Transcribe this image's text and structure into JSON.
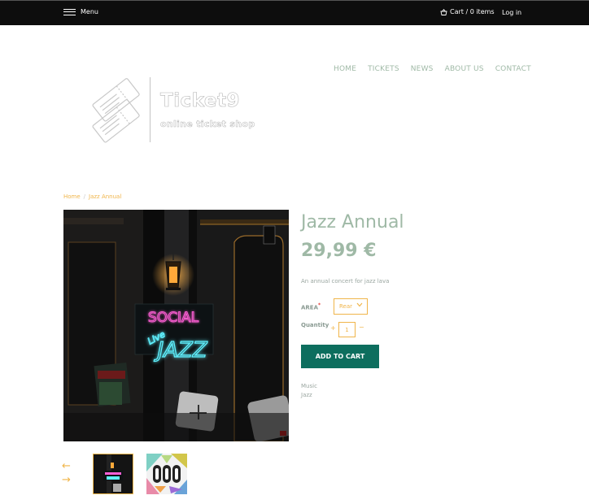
{
  "topbar": {
    "menu_label": "Menu",
    "cart_label": "Cart / 0 items",
    "login_label": "Log in"
  },
  "nav": {
    "items": [
      "HOME",
      "TICKETS",
      "NEWS",
      "ABOUT US",
      "CONTACT"
    ]
  },
  "logo": {
    "title": "Ticket9",
    "subtitle": "online ticket shop"
  },
  "breadcrumb": {
    "home": "Home",
    "separator": "/",
    "current": "Jazz Annual"
  },
  "product": {
    "title": "Jazz Annual",
    "price": "29,99 €",
    "description": "An annual concert for jazz lava",
    "area_label": "AREA",
    "area_required": "*",
    "area_value": "Rear",
    "quantity_label": "Quantity",
    "quantity_value": "1",
    "plus": "+",
    "minus": "−",
    "add_to_cart": "ADD TO CART",
    "tags": [
      "Music",
      "Jazz"
    ]
  },
  "image": {
    "neon_line1": "SOCIAL",
    "neon_live": "Live",
    "neon_line2": "JAZZ"
  },
  "gallery": {
    "prev_arrow": "←",
    "next_arrow": "→"
  },
  "colors": {
    "accent": "#f0b54a",
    "muted_green": "#9fb9a6",
    "button": "#0d6e5e",
    "topbar": "#0d0d0d"
  }
}
